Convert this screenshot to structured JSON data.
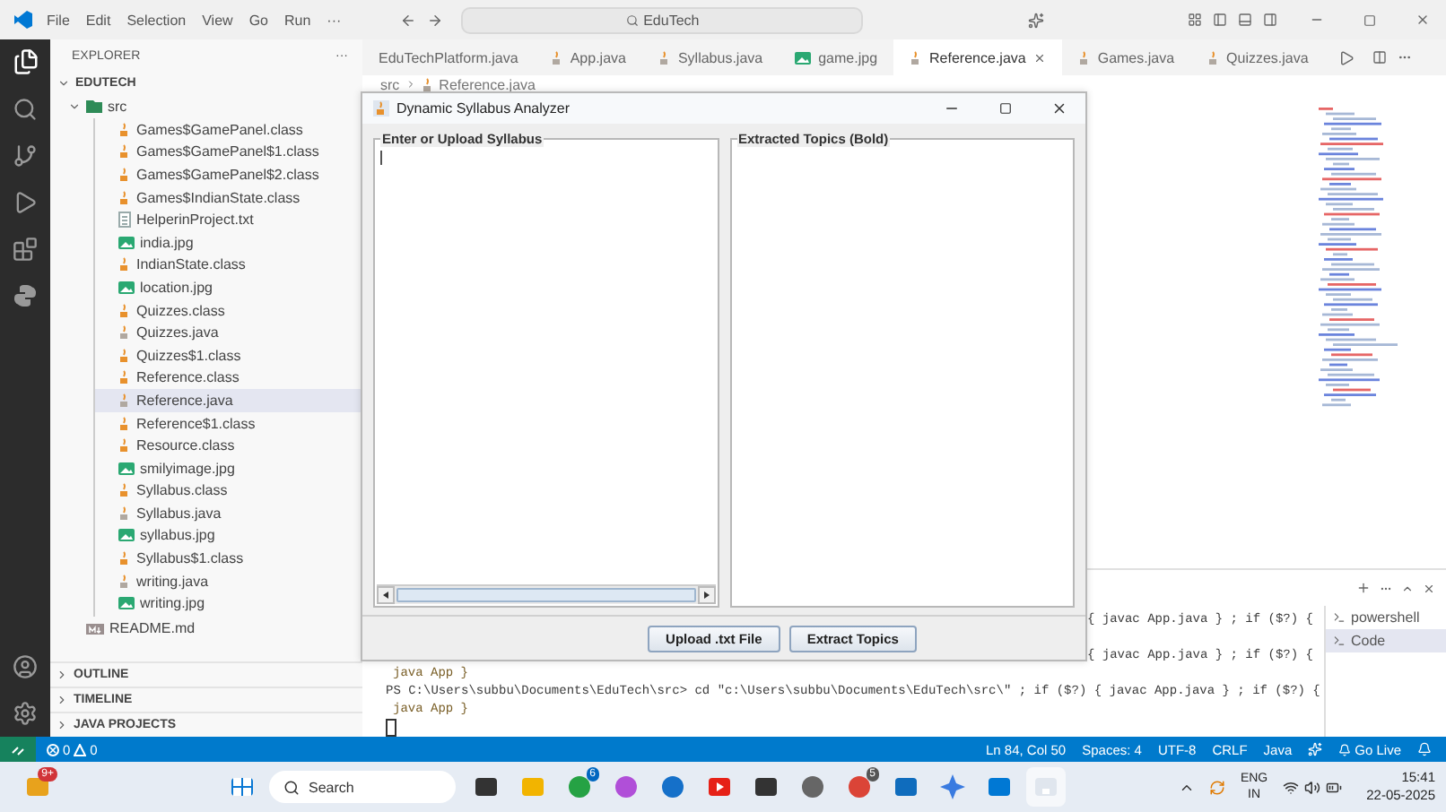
{
  "titlebar": {
    "menu": [
      "File",
      "Edit",
      "Selection",
      "View",
      "Go",
      "Run",
      "···"
    ],
    "search": "EduTech"
  },
  "sidebar": {
    "header": "EXPLORER",
    "more": "···",
    "root": "EDUTECH",
    "folder": "src",
    "files": [
      {
        "name": "Games$GamePanel.class",
        "kind": "class",
        "selected": false
      },
      {
        "name": "Games$GamePanel$1.class",
        "kind": "class",
        "selected": false
      },
      {
        "name": "Games$GamePanel$2.class",
        "kind": "class",
        "selected": false
      },
      {
        "name": "Games$IndianState.class",
        "kind": "class",
        "selected": false
      },
      {
        "name": "HelperinProject.txt",
        "kind": "text",
        "selected": false
      },
      {
        "name": "india.jpg",
        "kind": "image",
        "selected": false
      },
      {
        "name": "IndianState.class",
        "kind": "class",
        "selected": false
      },
      {
        "name": "location.jpg",
        "kind": "image",
        "selected": false
      },
      {
        "name": "Quizzes.class",
        "kind": "class",
        "selected": false
      },
      {
        "name": "Quizzes.java",
        "kind": "java",
        "selected": false
      },
      {
        "name": "Quizzes$1.class",
        "kind": "class",
        "selected": false
      },
      {
        "name": "Reference.class",
        "kind": "class",
        "selected": false
      },
      {
        "name": "Reference.java",
        "kind": "java",
        "selected": true
      },
      {
        "name": "Reference$1.class",
        "kind": "class",
        "selected": false
      },
      {
        "name": "Resource.class",
        "kind": "class",
        "selected": false
      },
      {
        "name": "smilyimage.jpg",
        "kind": "image",
        "selected": false
      },
      {
        "name": "Syllabus.class",
        "kind": "class",
        "selected": false
      },
      {
        "name": "Syllabus.java",
        "kind": "java",
        "selected": false
      },
      {
        "name": "syllabus.jpg",
        "kind": "image",
        "selected": false
      },
      {
        "name": "Syllabus$1.class",
        "kind": "class",
        "selected": false
      },
      {
        "name": "writing.java",
        "kind": "java",
        "selected": false
      },
      {
        "name": "writing.jpg",
        "kind": "image",
        "selected": false
      }
    ],
    "root_files": [
      {
        "name": "README.md",
        "kind": "markdown",
        "selected": false
      }
    ],
    "sections": [
      "OUTLINE",
      "TIMELINE",
      "JAVA PROJECTS"
    ]
  },
  "tabs": [
    {
      "label": "EduTechPlatform.java",
      "kind": "none",
      "selected": false
    },
    {
      "label": "App.java",
      "kind": "java",
      "selected": false
    },
    {
      "label": "Syllabus.java",
      "kind": "java",
      "selected": false
    },
    {
      "label": "game.jpg",
      "kind": "image",
      "selected": false
    },
    {
      "label": "Reference.java",
      "kind": "java",
      "selected": true
    },
    {
      "label": "Games.java",
      "kind": "java",
      "selected": false
    },
    {
      "label": "Quizzes.java",
      "kind": "java",
      "selected": false
    }
  ],
  "breadcrumb": [
    "src",
    "Reference.java"
  ],
  "terminal": {
    "lines": [
      {
        "text": "{ javac App.java } ; if ($?) {",
        "kind": "tail"
      },
      {
        "text": "{ javac App.java } ; if ($?) {",
        "kind": "tail"
      },
      {
        "text": "java App }",
        "kind": "indent"
      },
      {
        "text": "PS C:\\Users\\subbu\\Documents\\EduTech\\src> cd \"c:\\Users\\subbu\\Documents\\EduTech\\src\\\" ; if ($?) { javac App.java } ; if ($?) {",
        "kind": "full"
      },
      {
        "text": "java App }",
        "kind": "indent"
      }
    ],
    "shells": [
      {
        "label": "powershell",
        "selected": false
      },
      {
        "label": "Code",
        "selected": true
      }
    ]
  },
  "status_bar": {
    "errors": "0",
    "warnings": "0",
    "items": [
      "Ln 84, Col 50",
      "Spaces: 4",
      "UTF-8",
      "CRLF",
      "Java"
    ],
    "go_live": "Go Live"
  },
  "dialog": {
    "title": "Dynamic Syllabus Analyzer",
    "input_title": "Enter or Upload Syllabus",
    "output_title": "Extracted Topics (Bold)",
    "buttons": [
      "Upload .txt File",
      "Extract Topics"
    ]
  },
  "taskbar": {
    "weather_badge": "9+",
    "search": "Search",
    "whatsapp_badge": "6",
    "chrome_badge": "5",
    "language": "ENG",
    "region": "IN",
    "time": "15:41",
    "date": "22-05-2025"
  }
}
